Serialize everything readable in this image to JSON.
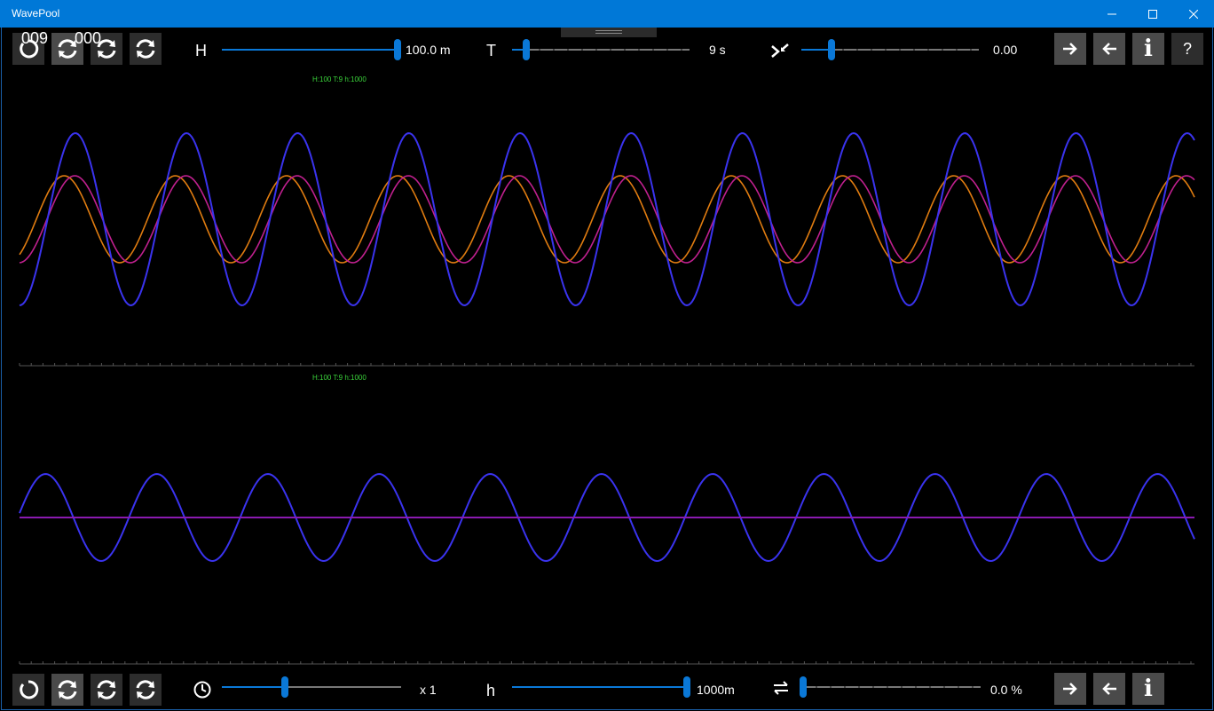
{
  "window": {
    "title": "WavePool"
  },
  "top": {
    "counter_left": "009",
    "counter_right": "000",
    "height": {
      "label": "H",
      "value": "100.0 m",
      "level": 1.0
    },
    "period": {
      "label": "T",
      "value": "9 s",
      "level": 0.08
    },
    "third": {
      "value": "0.00",
      "level": 0.17
    },
    "info_label": "i",
    "help_label": "?"
  },
  "bottom": {
    "speed": {
      "value": "x 1",
      "level": 0.35
    },
    "depth": {
      "label": "h",
      "value": "1000m",
      "level": 1.0
    },
    "fourth": {
      "value": "0.0 %",
      "level": 0.0
    },
    "info_label": "i"
  },
  "panels": {
    "upper_tag": "H:100  T:9  h:1000",
    "lower_tag": "H:100  T:9  h:1000"
  },
  "colors": {
    "titlebar": "#0078d7",
    "accent": "#0a78d7",
    "wave_blue": "#3a33ee",
    "wave_orange": "#e07c10",
    "wave_magenta": "#c0208f",
    "flat_line": "#8a1ab0",
    "tag_green": "#3bd43b"
  },
  "icons": {
    "reset": "reset-icon",
    "refresh": "refresh-icon",
    "next": "arrow-right-icon",
    "prev": "arrow-left-icon",
    "clock": "clock-icon"
  }
}
